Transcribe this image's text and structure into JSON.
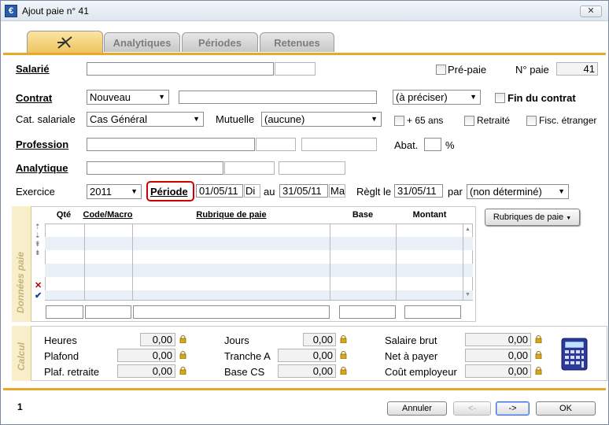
{
  "window": {
    "title": "Ajout paie n° 41",
    "close_label": "✕",
    "icon_glyph": "€"
  },
  "tabs": [
    {
      "label": ""
    },
    {
      "label": "Analytiques"
    },
    {
      "label": "Périodes"
    },
    {
      "label": "Retenues"
    }
  ],
  "salarie": {
    "label": "Salarié",
    "value": "",
    "pre_paie": "Pré-paie",
    "no_paie_label": "N° paie",
    "no_paie": "41"
  },
  "contrat": {
    "label": "Contrat",
    "type": "Nouveau",
    "detail": "",
    "preciser": "(à préciser)",
    "fin_contrat": "Fin du contrat"
  },
  "cat": {
    "label": "Cat. salariale",
    "value": "Cas Général",
    "mutuelle_label": "Mutuelle",
    "mutuelle": "(aucune)",
    "plus65": "+ 65 ans",
    "retraite": "Retraité",
    "fisc": "Fisc. étranger"
  },
  "profession": {
    "label": "Profession",
    "abat_label": "Abat.",
    "abat": "",
    "pct": "%"
  },
  "analytique": {
    "label": "Analytique"
  },
  "exercice": {
    "label": "Exercice",
    "value": "2011",
    "periode_label": "Période",
    "du": "01/05/11",
    "du_day": "Di",
    "au_label": "au",
    "au": "31/05/11",
    "au_day": "Ma",
    "reglt_label": "Règlt le",
    "reglt": "31/05/11",
    "par_label": "par",
    "par": "(non déterminé)"
  },
  "grid": {
    "side": "Données paie",
    "headers": [
      "Qté",
      "Code/Macro",
      "Rubrique de paie",
      "Base",
      "Montant"
    ],
    "rubriques_btn": "Rubriques de paie"
  },
  "calcul": {
    "side": "Calcul",
    "heures": "Heures",
    "heures_v": "0,00",
    "plafond": "Plafond",
    "plafond_v": "0,00",
    "plaf_retraite": "Plaf. retraite",
    "plaf_retraite_v": "0,00",
    "jours": "Jours",
    "jours_v": "0,00",
    "tranche_a": "Tranche A",
    "tranche_a_v": "0,00",
    "base_cs": "Base CS",
    "base_cs_v": "0,00",
    "salaire_brut": "Salaire brut",
    "salaire_brut_v": "0,00",
    "net": "Net à payer",
    "net_v": "0,00",
    "cout": "Coût employeur",
    "cout_v": "0,00"
  },
  "footer": {
    "page": "1",
    "annuler": "Annuler",
    "prev": "<-",
    "next": "->",
    "ok": "OK"
  },
  "colors": {
    "accent": "#e8a828",
    "tab_active": "#eec460",
    "highlight": "#d00000"
  }
}
